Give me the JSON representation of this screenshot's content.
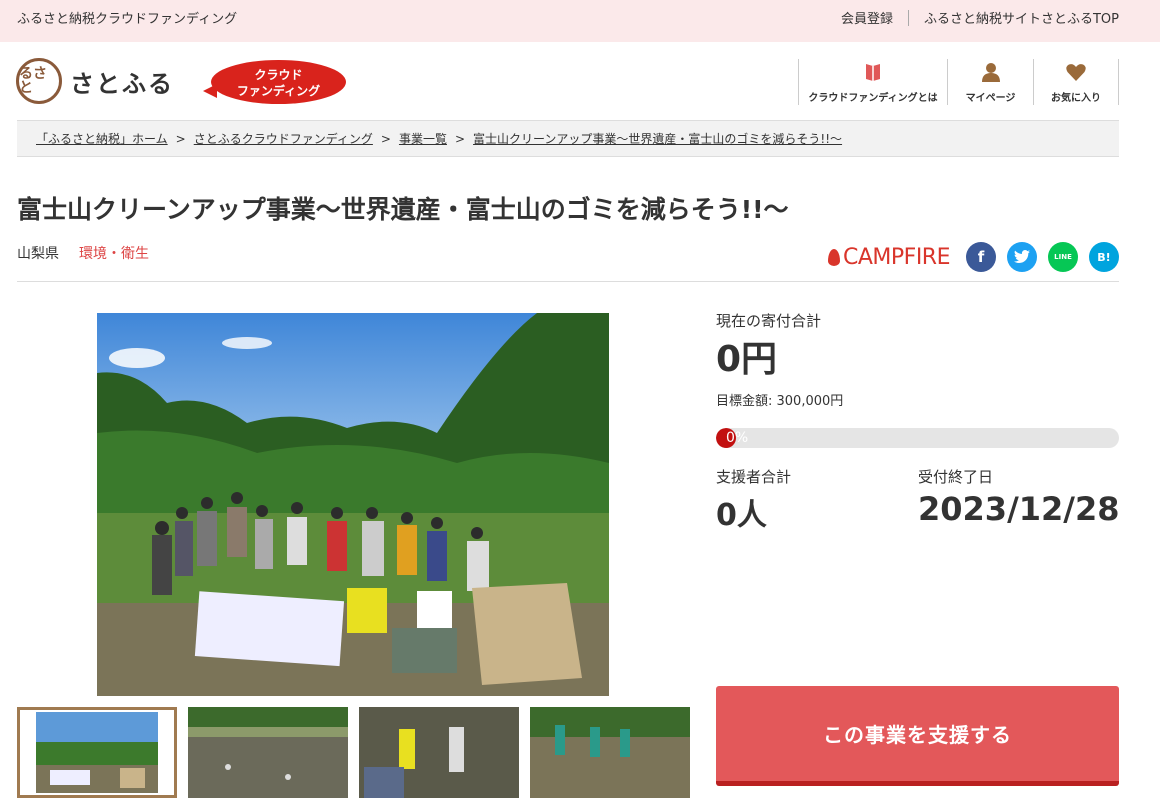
{
  "topbar": {
    "site_name": "ふるさと納税クラウドファンディング",
    "register": "会員登録",
    "top_link": "ふるさと納税サイトさとふるTOP"
  },
  "logo": {
    "seal": "るさと",
    "name": "さとふる",
    "badge_line1": "クラウド",
    "badge_line2": "ファンディング"
  },
  "header_nav": [
    {
      "label": "クラウドファンディングとは",
      "icon": "info-book-icon"
    },
    {
      "label": "マイページ",
      "icon": "person-icon"
    },
    {
      "label": "お気に入り",
      "icon": "heart-icon"
    }
  ],
  "breadcrumb": [
    "「ふるさと納税」ホーム",
    "さとふるクラウドファンディング",
    "事業一覧",
    "富士山クリーンアップ事業〜世界遺産・富士山のゴミを減らそう!!〜"
  ],
  "breadcrumb_sep": ">",
  "project": {
    "title": "富士山クリーンアップ事業〜世界遺産・富士山のゴミを減らそう!!〜",
    "prefecture": "山梨県",
    "category": "環境・衛生"
  },
  "share": {
    "campfire": "CAMPFIRE",
    "facebook": "f",
    "twitter": "t",
    "line": "LINE",
    "hatena": "B!"
  },
  "stats": {
    "total_label": "現在の寄付合計",
    "total_value": "0円",
    "goal_text": "目標金額: 300,000円",
    "progress_percent": 0,
    "progress_text": "0%",
    "supporters_label": "支援者合計",
    "supporters_value": "0人",
    "deadline_label": "受付終了日",
    "deadline_value": "2023/12/28"
  },
  "cta": {
    "label": "この事業を支援する"
  },
  "colors": {
    "accent": "#e3585a",
    "progress_fill": "#c21010",
    "topbar_bg": "#fbe9ea"
  }
}
